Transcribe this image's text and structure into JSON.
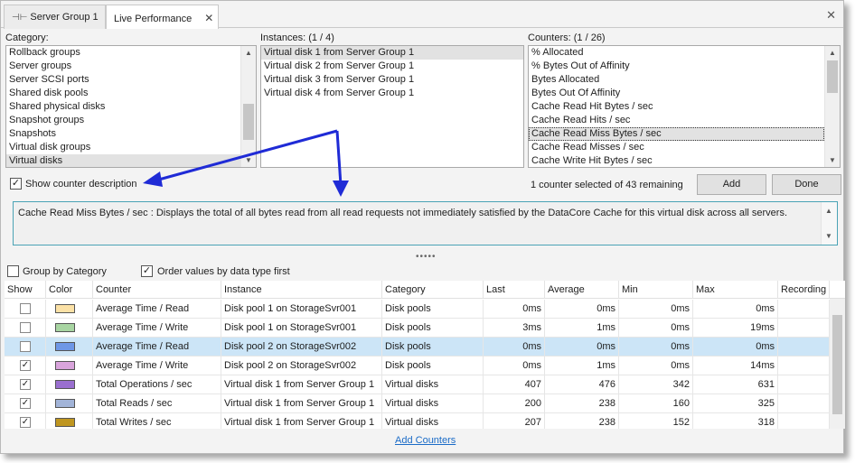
{
  "tabs": [
    {
      "label": "Server Group 1",
      "icon": "server-group-icon"
    },
    {
      "label": "Live Performance",
      "icon": "close-icon"
    }
  ],
  "category": {
    "label": "Category:",
    "items": [
      "Rollback groups",
      "Server groups",
      "Server SCSI ports",
      "Shared disk pools",
      "Shared physical disks",
      "Snapshot groups",
      "Snapshots",
      "Virtual disk groups",
      "Virtual disks"
    ],
    "selected": "Virtual disks"
  },
  "instances": {
    "label": "Instances: (1 / 4)",
    "items": [
      "Virtual disk 1 from Server Group 1",
      "Virtual disk 2 from Server Group 1",
      "Virtual disk 3 from Server Group 1",
      "Virtual disk 4 from Server Group 1"
    ],
    "selected": "Virtual disk 1 from Server Group 1"
  },
  "counters": {
    "label": "Counters: (1 / 26)",
    "items": [
      "% Allocated",
      "% Bytes Out of Affinity",
      "Bytes Allocated",
      "Bytes Out Of Affinity",
      "Cache Read Hit Bytes / sec",
      "Cache Read Hits / sec",
      "Cache Read Miss Bytes / sec",
      "Cache Read Misses / sec",
      "Cache Write Hit Bytes / sec"
    ],
    "selected": "Cache Read Miss Bytes / sec"
  },
  "show_counter_description": {
    "label": "Show counter description",
    "checked": true
  },
  "status_text": "1 counter selected of 43 remaining",
  "buttons": {
    "add": "Add",
    "done": "Done"
  },
  "description": "Cache Read Miss Bytes / sec : Displays the total of all bytes read from all read requests not immediately satisfied by the DataCore Cache for this virtual disk across all servers.",
  "options": {
    "group_by_category": {
      "label": "Group by Category",
      "checked": false
    },
    "order_values": {
      "label": "Order values by data type first",
      "checked": true
    }
  },
  "grid": {
    "columns": [
      "Show",
      "Color",
      "Counter",
      "Instance",
      "Category",
      "Last",
      "Average",
      "Min",
      "Max",
      "Recording"
    ],
    "rows": [
      {
        "show": false,
        "color": "#fbe1a6",
        "counter": "Average Time / Read",
        "instance": "Disk pool 1 on StorageSvr001",
        "category": "Disk pools",
        "last": "0ms",
        "average": "0ms",
        "min": "0ms",
        "max": "0ms",
        "recording": ""
      },
      {
        "show": false,
        "color": "#a8d5a2",
        "counter": "Average Time / Write",
        "instance": "Disk pool 1 on StorageSvr001",
        "category": "Disk pools",
        "last": "3ms",
        "average": "1ms",
        "min": "0ms",
        "max": "19ms",
        "recording": ""
      },
      {
        "show": false,
        "color": "#6f97e6",
        "counter": "Average Time / Read",
        "instance": "Disk pool 2 on StorageSvr002",
        "category": "Disk pools",
        "last": "0ms",
        "average": "0ms",
        "min": "0ms",
        "max": "0ms",
        "recording": "",
        "selected": true
      },
      {
        "show": true,
        "color": "#d9a4dc",
        "counter": "Average Time / Write",
        "instance": "Disk pool 2 on StorageSvr002",
        "category": "Disk pools",
        "last": "0ms",
        "average": "1ms",
        "min": "0ms",
        "max": "14ms",
        "recording": ""
      },
      {
        "show": true,
        "color": "#9a6fd0",
        "counter": "Total Operations / sec",
        "instance": "Virtual disk 1 from Server Group 1",
        "category": "Virtual disks",
        "last": "407",
        "average": "476",
        "min": "342",
        "max": "631",
        "recording": ""
      },
      {
        "show": true,
        "color": "#a2b4d8",
        "counter": "Total Reads / sec",
        "instance": "Virtual disk 1 from Server Group 1",
        "category": "Virtual disks",
        "last": "200",
        "average": "238",
        "min": "160",
        "max": "325",
        "recording": ""
      },
      {
        "show": true,
        "color": "#bf9620",
        "counter": "Total Writes / sec",
        "instance": "Virtual disk 1 from Server Group 1",
        "category": "Virtual disks",
        "last": "207",
        "average": "238",
        "min": "152",
        "max": "318",
        "recording": ""
      }
    ]
  },
  "add_counters_link": "Add Counters",
  "annotation_color": "#1f2bd6"
}
